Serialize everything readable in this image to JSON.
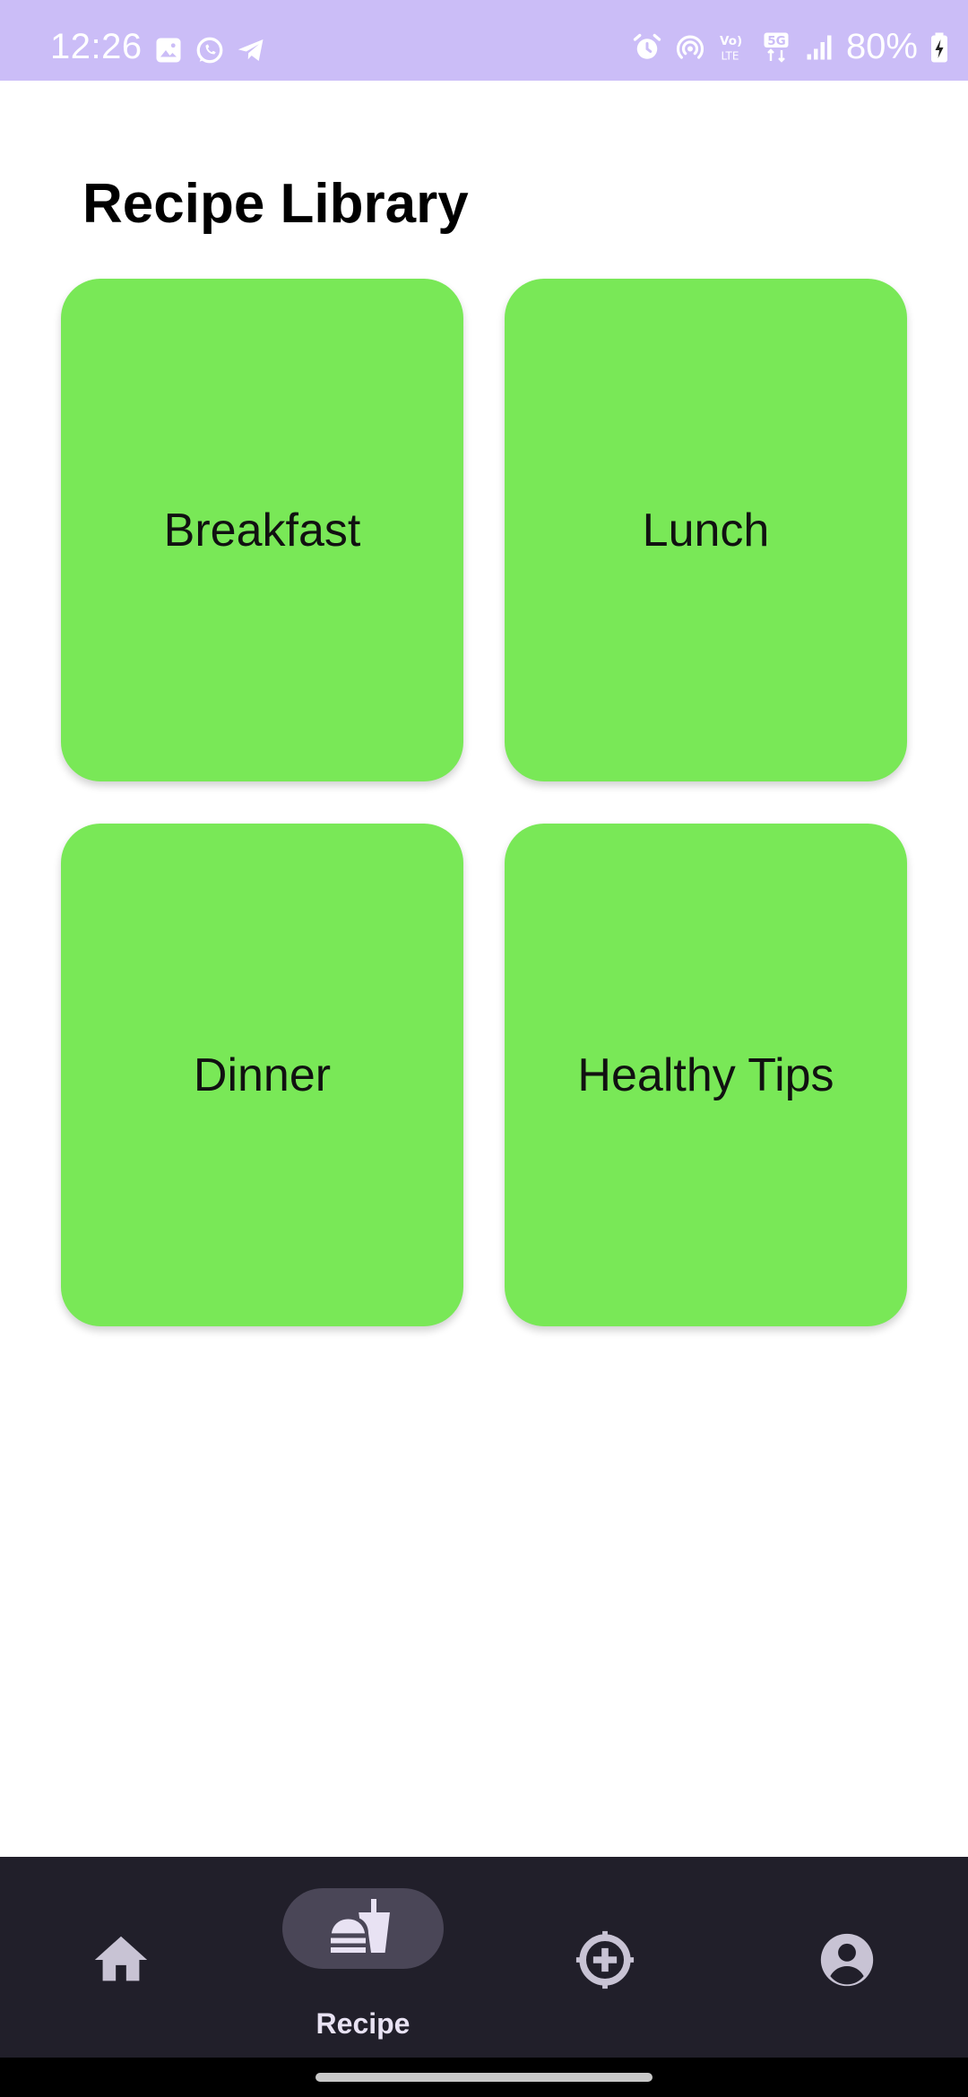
{
  "status_bar": {
    "time": "12:26",
    "battery_percent": "80%",
    "bg_color": "#cbbdf7",
    "left_icons": [
      "gallery-icon",
      "whatsapp-icon",
      "telegram-icon"
    ],
    "right_icons": [
      "alarm-icon",
      "hotspot-icon",
      "volte-icon",
      "5g-icon",
      "signal-icon",
      "battery-charging-icon"
    ],
    "volte_label": "Vo) LTE",
    "network_label": "5G"
  },
  "page": {
    "title": "Recipe Library"
  },
  "cards": [
    {
      "label": "Breakfast"
    },
    {
      "label": "Lunch"
    },
    {
      "label": "Dinner"
    },
    {
      "label": "Healthy Tips"
    }
  ],
  "card_color": "#79e857",
  "bottom_nav": {
    "bg_color": "#211f2a",
    "items": [
      {
        "icon": "home-icon",
        "label": "",
        "selected": false
      },
      {
        "icon": "fastfood-icon",
        "label": "Recipe",
        "selected": true
      },
      {
        "icon": "add-circle-icon",
        "label": "",
        "selected": false
      },
      {
        "icon": "account-circle-icon",
        "label": "",
        "selected": false
      }
    ]
  }
}
